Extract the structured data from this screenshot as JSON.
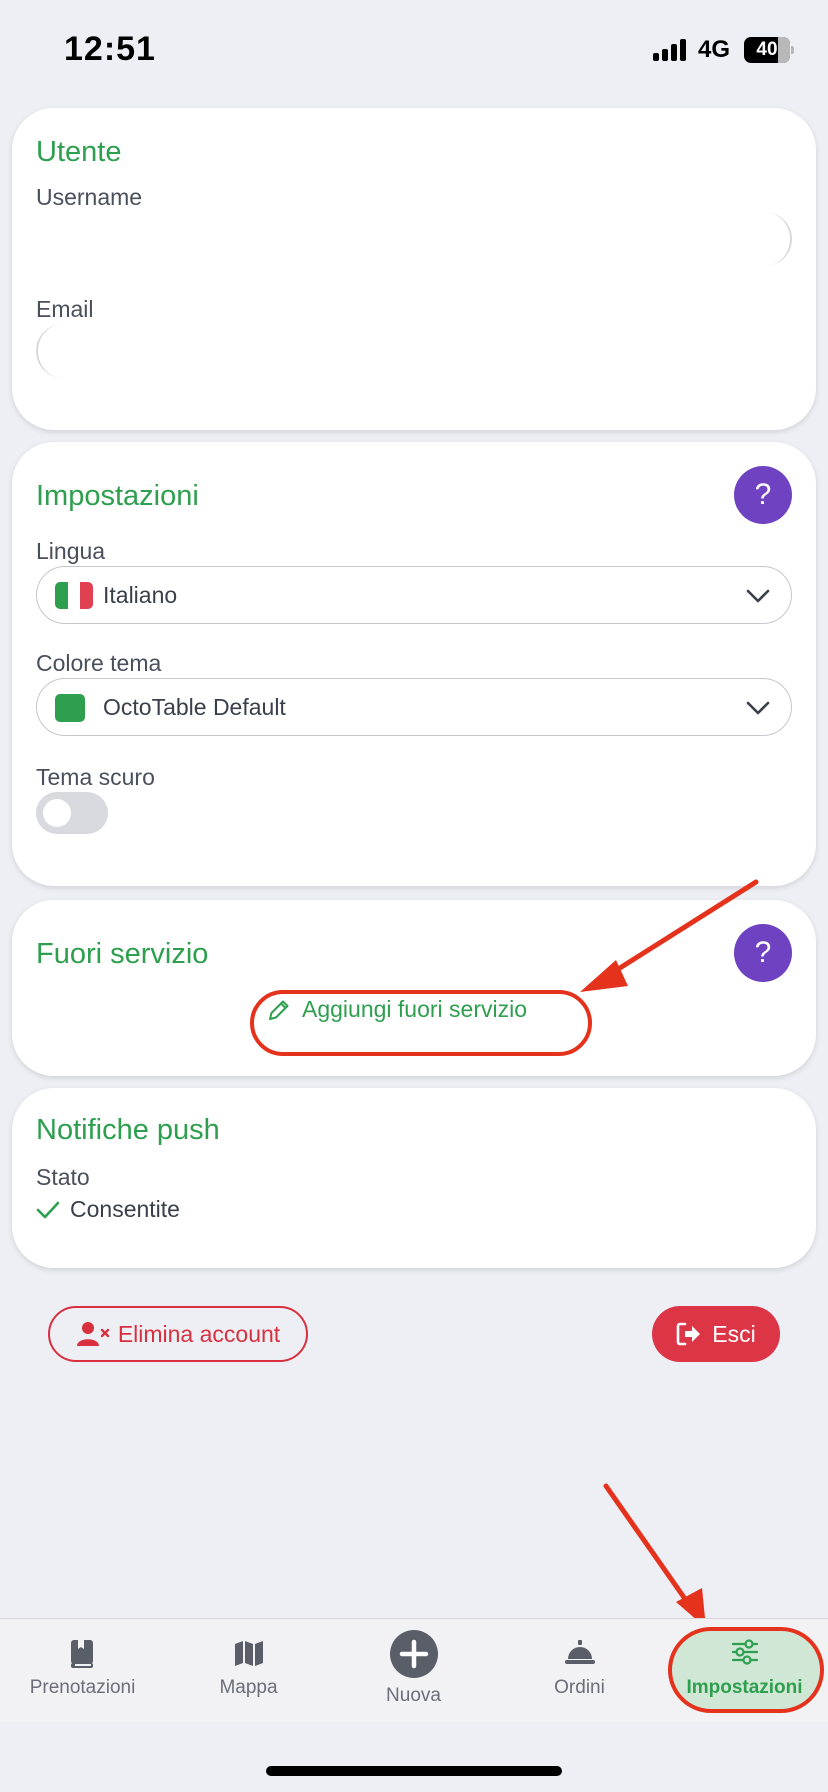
{
  "status": {
    "time": "12:51",
    "network": "4G",
    "battery": "40"
  },
  "user_card": {
    "title": "Utente",
    "username_label": "Username",
    "email_label": "Email"
  },
  "settings_card": {
    "title": "Impostazioni",
    "help": "?",
    "language_label": "Lingua",
    "language_value": "Italiano",
    "theme_color_label": "Colore tema",
    "theme_color_value": "OctoTable Default",
    "dark_theme_label": "Tema scuro",
    "dark_theme_enabled": false
  },
  "out_of_service_card": {
    "title": "Fuori servizio",
    "help": "?",
    "add_label": "Aggiungi fuori servizio"
  },
  "push_card": {
    "title": "Notifiche push",
    "status_label": "Stato",
    "status_value": "Consentite"
  },
  "actions": {
    "delete_account": "Elimina account",
    "logout": "Esci"
  },
  "tabbar": {
    "items": [
      {
        "label": "Prenotazioni",
        "icon": "book-icon"
      },
      {
        "label": "Mappa",
        "icon": "map-icon"
      },
      {
        "label": "Nuova",
        "icon": "plus-circle-icon"
      },
      {
        "label": "Ordini",
        "icon": "service-bell-icon"
      },
      {
        "label": "Impostazioni",
        "icon": "sliders-icon"
      }
    ],
    "active_index": 4
  },
  "colors": {
    "accent": "#2e9f4f",
    "help": "#6f42c1",
    "danger": "#dc3545",
    "annotation": "#e5321c"
  }
}
